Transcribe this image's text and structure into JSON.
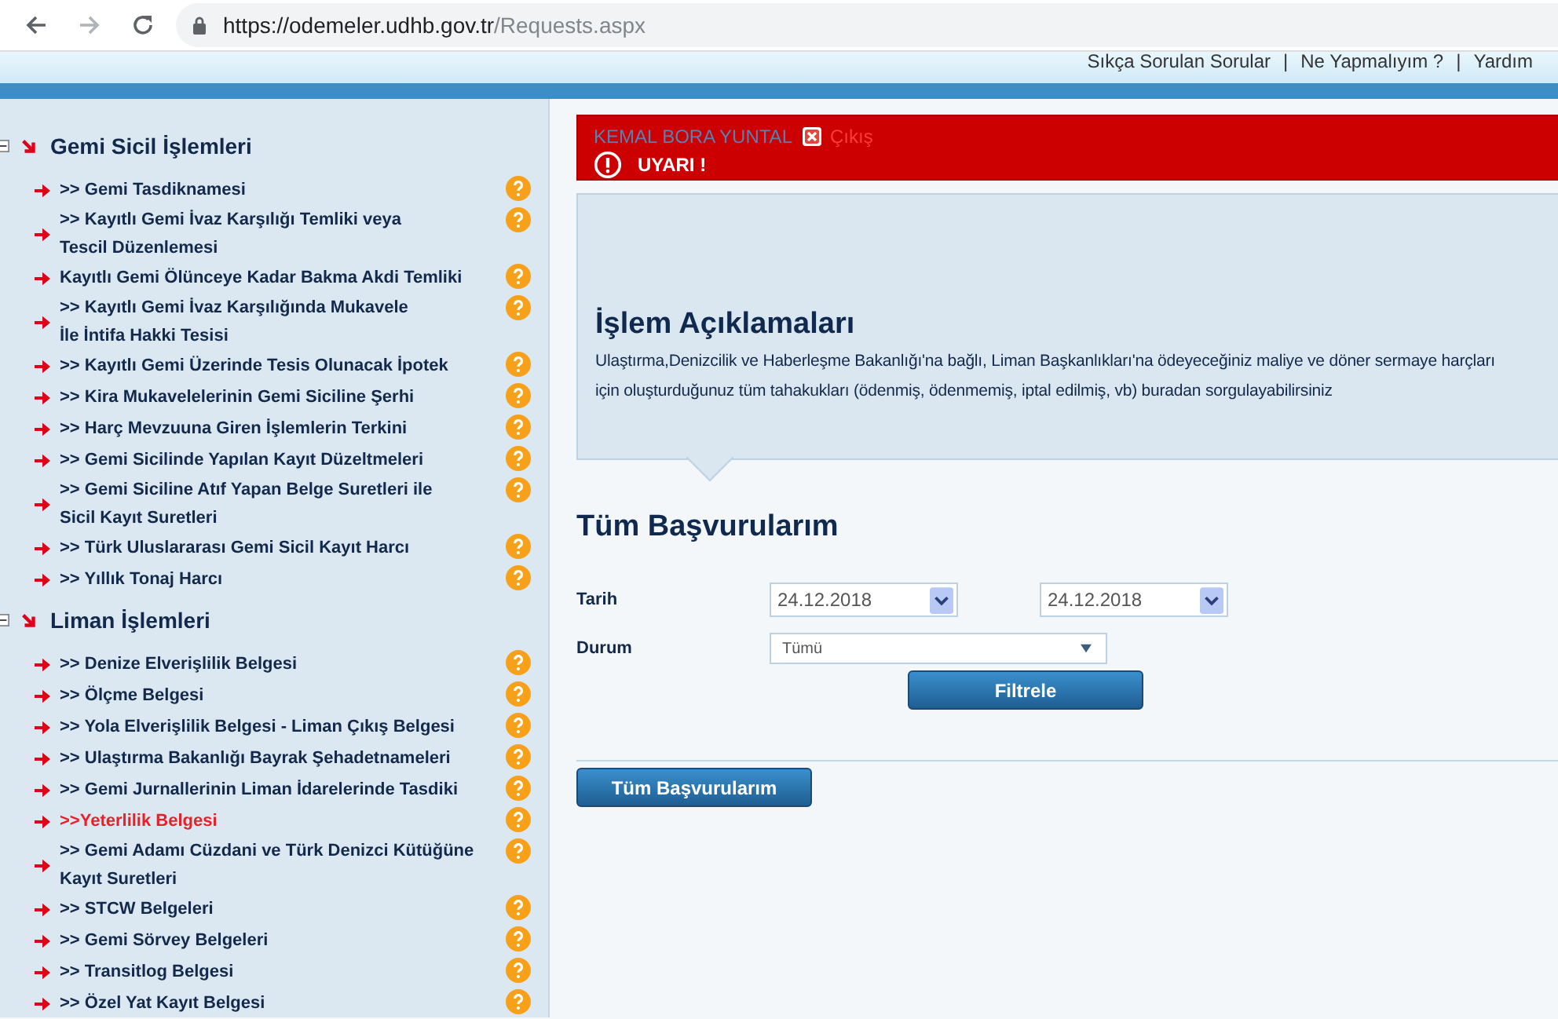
{
  "browser": {
    "url_host": "https://odemeler.udhb.gov.tr",
    "url_path": "/Requests.aspx"
  },
  "header": {
    "links": [
      "Sıkça Sorulan Sorular",
      "Ne Yapmalıyım ?",
      "Yardım"
    ],
    "separator": "|"
  },
  "sidebar": {
    "sections": [
      {
        "title": "Gemi Sicil İşlemleri",
        "expanded": true,
        "items": [
          {
            "lines": [
              ">> Gemi Tasdiknamesi"
            ],
            "selected": false
          },
          {
            "lines": [
              ">> Kayıtlı Gemi İvaz Karşılığı Temliki veya",
              "Tescil Düzenlemesi"
            ],
            "selected": false
          },
          {
            "lines": [
              "Kayıtlı Gemi Ölünceye Kadar Bakma Akdi Temliki"
            ],
            "selected": false
          },
          {
            "lines": [
              ">> Kayıtlı Gemi İvaz Karşılığında Mukavele",
              "İle İntifa Hakki Tesisi"
            ],
            "selected": false
          },
          {
            "lines": [
              ">> Kayıtlı Gemi Üzerinde Tesis Olunacak İpotek"
            ],
            "selected": false
          },
          {
            "lines": [
              ">> Kira Mukavelelerinin Gemi Siciline Şerhi"
            ],
            "selected": false
          },
          {
            "lines": [
              ">> Harç Mevzuuna Giren İşlemlerin Terkini"
            ],
            "selected": false
          },
          {
            "lines": [
              ">> Gemi Sicilinde Yapılan Kayıt Düzeltmeleri"
            ],
            "selected": false
          },
          {
            "lines": [
              ">> Gemi Siciline Atıf Yapan Belge Suretleri ile",
              "Sicil Kayıt Suretleri"
            ],
            "selected": false
          },
          {
            "lines": [
              ">> Türk Uluslararası Gemi Sicil Kayıt Harcı"
            ],
            "selected": false
          },
          {
            "lines": [
              ">> Yıllık Tonaj Harcı"
            ],
            "selected": false
          }
        ]
      },
      {
        "title": "Liman İşlemleri",
        "expanded": true,
        "items": [
          {
            "lines": [
              ">> Denize Elverişlilik Belgesi"
            ],
            "selected": false
          },
          {
            "lines": [
              ">> Ölçme Belgesi"
            ],
            "selected": false
          },
          {
            "lines": [
              ">> Yola Elverişlilik Belgesi - Liman Çıkış Belgesi"
            ],
            "selected": false
          },
          {
            "lines": [
              ">> Ulaştırma Bakanlığı Bayrak Şehadetnameleri"
            ],
            "selected": false
          },
          {
            "lines": [
              ">> Gemi Jurnallerinin Liman İdarelerinde Tasdiki"
            ],
            "selected": false
          },
          {
            "lines": [
              ">>Yeterlilik Belgesi"
            ],
            "selected": true
          },
          {
            "lines": [
              ">> Gemi Adamı Cüzdani ve Türk Denizci Kütüğüne",
              "Kayıt Suretleri"
            ],
            "selected": false
          },
          {
            "lines": [
              ">> STCW Belgeleri"
            ],
            "selected": false
          },
          {
            "lines": [
              ">> Gemi Sörvey Belgeleri"
            ],
            "selected": false
          },
          {
            "lines": [
              ">> Transitlog Belgesi"
            ],
            "selected": false
          },
          {
            "lines": [
              ">> Özel Yat Kayıt Belgesi"
            ],
            "selected": false
          }
        ]
      }
    ]
  },
  "user_bar": {
    "user": "KEMAL BORA YUNTAL",
    "logout": "Çıkış",
    "warning": "UYARI !"
  },
  "info": {
    "title": "İşlem Açıklamaları",
    "text_lines": [
      "Ulaştırma,Denizcilik ve Haberleşme Bakanlığı'na bağlı, Liman Başkanlıkları'na ödeyeceğiniz maliye ve döner sermaye harçları",
      "için oluşturduğunuz tüm tahakukları (ödenmiş, ödenmemiş, iptal edilmiş, vb) buradan sorgulayabilirsiniz"
    ]
  },
  "filter": {
    "title": "Tüm Başvurularım",
    "date_label": "Tarih",
    "date_from": "24.12.2018",
    "date_to": "24.12.2018",
    "status_label": "Durum",
    "status_value": "Tümü",
    "filter_button": "Filtrele"
  },
  "all_button": "Tüm Başvurularım"
}
